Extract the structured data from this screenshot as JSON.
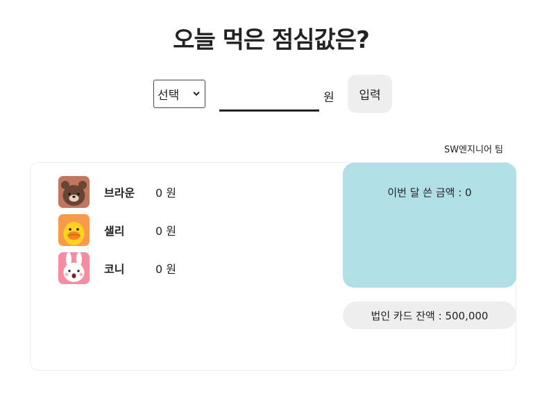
{
  "title": "오늘 먹은 점심값은?",
  "form": {
    "select_value": "선택",
    "amount_value": "",
    "unit": "원",
    "submit_label": "입력"
  },
  "team_name": "SW엔지니어 팀",
  "members": [
    {
      "name": "브라운",
      "amount": "0 원",
      "icon": "brown-bear-icon"
    },
    {
      "name": "샐리",
      "amount": "0 원",
      "icon": "sally-chick-icon"
    },
    {
      "name": "코니",
      "amount": "0 원",
      "icon": "cony-rabbit-icon"
    }
  ],
  "summary": {
    "spent_label": "이번 달 쓴 금액 : 0",
    "balance_label": "법인 카드 잔액 : 500,000"
  },
  "colors": {
    "spent_bg": "#b0dfe5",
    "balance_bg": "#eeeeee",
    "button_bg": "#eeeeee"
  }
}
